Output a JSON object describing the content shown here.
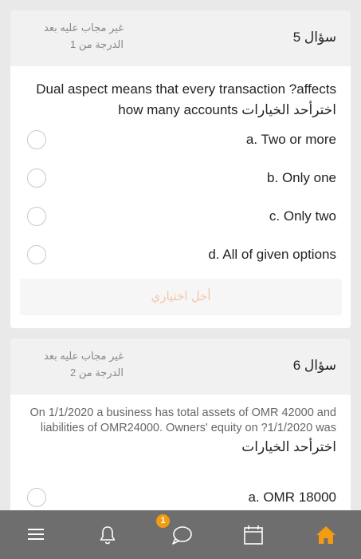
{
  "questions": [
    {
      "number_label": "سؤال 5",
      "status": "غير مجاب عليه بعد",
      "grade": "الدرجة من 1",
      "text": "Dual aspect means that every transaction ?affects how many accounts اخترأحد الخيارات",
      "options": [
        {
          "label": "a. Two or more"
        },
        {
          "label": "b. Only one"
        },
        {
          "label": "c. Only two"
        },
        {
          "label": "d. All of given options"
        }
      ],
      "clear_label": "أخل اختياري"
    },
    {
      "number_label": "سؤال 6",
      "status": "غير مجاب عليه بعد",
      "grade": "الدرجة من 2",
      "text": "On 1/1/2020 a business has total assets of OMR 42000 and liabilities of OMR24000. Owners' equity on ?1/1/2020 was",
      "prompt": "اخترأحد الخيارات",
      "options": [
        {
          "label": "a. OMR 18000"
        }
      ]
    }
  ],
  "tabbar": {
    "notification_count": "1",
    "icons": [
      "menu-icon",
      "bell-icon",
      "chat-icon",
      "calendar-icon",
      "home-icon"
    ],
    "active_color": "#f39c12",
    "icon_color": "#ffffff"
  }
}
